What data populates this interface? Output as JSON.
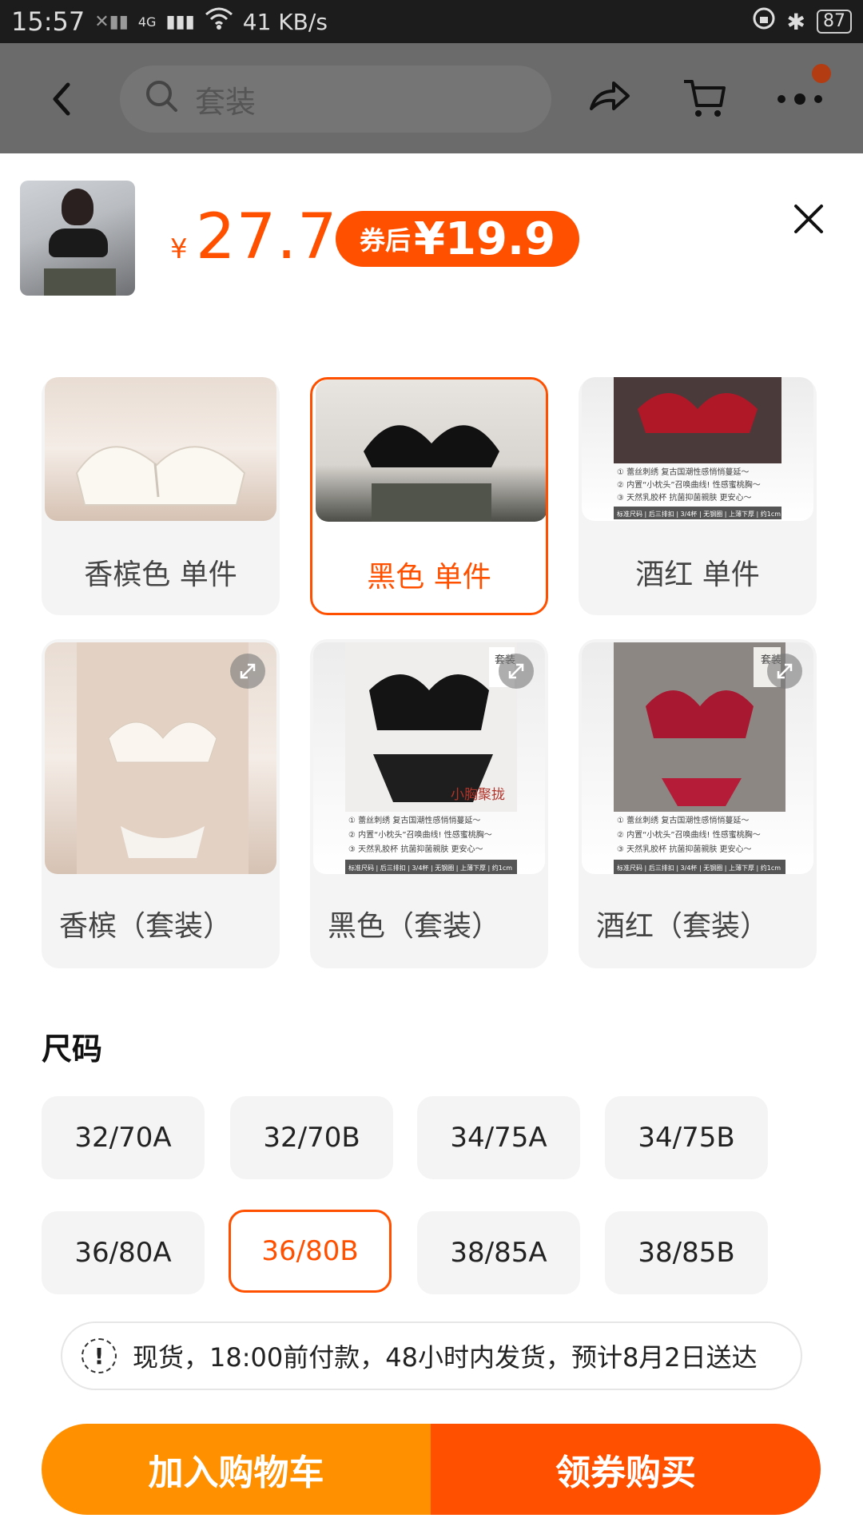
{
  "status_bar": {
    "time": "15:57",
    "network": "4G",
    "speed": "41 KB/s",
    "battery": "87"
  },
  "header": {
    "search_placeholder": "套装"
  },
  "product": {
    "currency": "¥",
    "price": "27.7",
    "coupon_label": "券后",
    "coupon_price": "¥19.9"
  },
  "variants": [
    {
      "label": "香槟色 单件",
      "selected": false
    },
    {
      "label": "黑色 单件",
      "selected": true
    },
    {
      "label": "酒红 单件",
      "selected": false
    },
    {
      "label": "香槟（套装）",
      "selected": false
    },
    {
      "label": "黑色（套装）",
      "selected": false
    },
    {
      "label": "酒红（套装）",
      "selected": false
    }
  ],
  "variant_image_text": {
    "set_badge": "套装",
    "caption": "小胸聚拢",
    "bullets": [
      "① 蕾丝刺绣 复古国潮性感悄悄蔓延～",
      "② 内置“小枕头”召唤曲线! 性感蜜桃胸～",
      "③ 天然乳胶杯 抗菌抑菌親肤 更安心～"
    ],
    "spec": "标准尺码 | 后三排扣 | 3/4杯 | 无钢圈 | 上薄下厚 | 约1cm"
  },
  "size_section": {
    "title": "尺码",
    "options": [
      "32/70A",
      "32/70B",
      "34/75A",
      "34/75B",
      "36/80A",
      "36/80B",
      "38/85A",
      "38/85B"
    ],
    "selected": "36/80B"
  },
  "shipping": {
    "icon": "!",
    "text": "现货，18:00前付款，48小时内发货，预计8月2日送达"
  },
  "actions": {
    "add_to_cart": "加入购物车",
    "buy": "领券购买"
  },
  "colors": {
    "accent": "#ff5000",
    "cart": "#ff9000",
    "chip_bg": "#f4f4f4"
  }
}
